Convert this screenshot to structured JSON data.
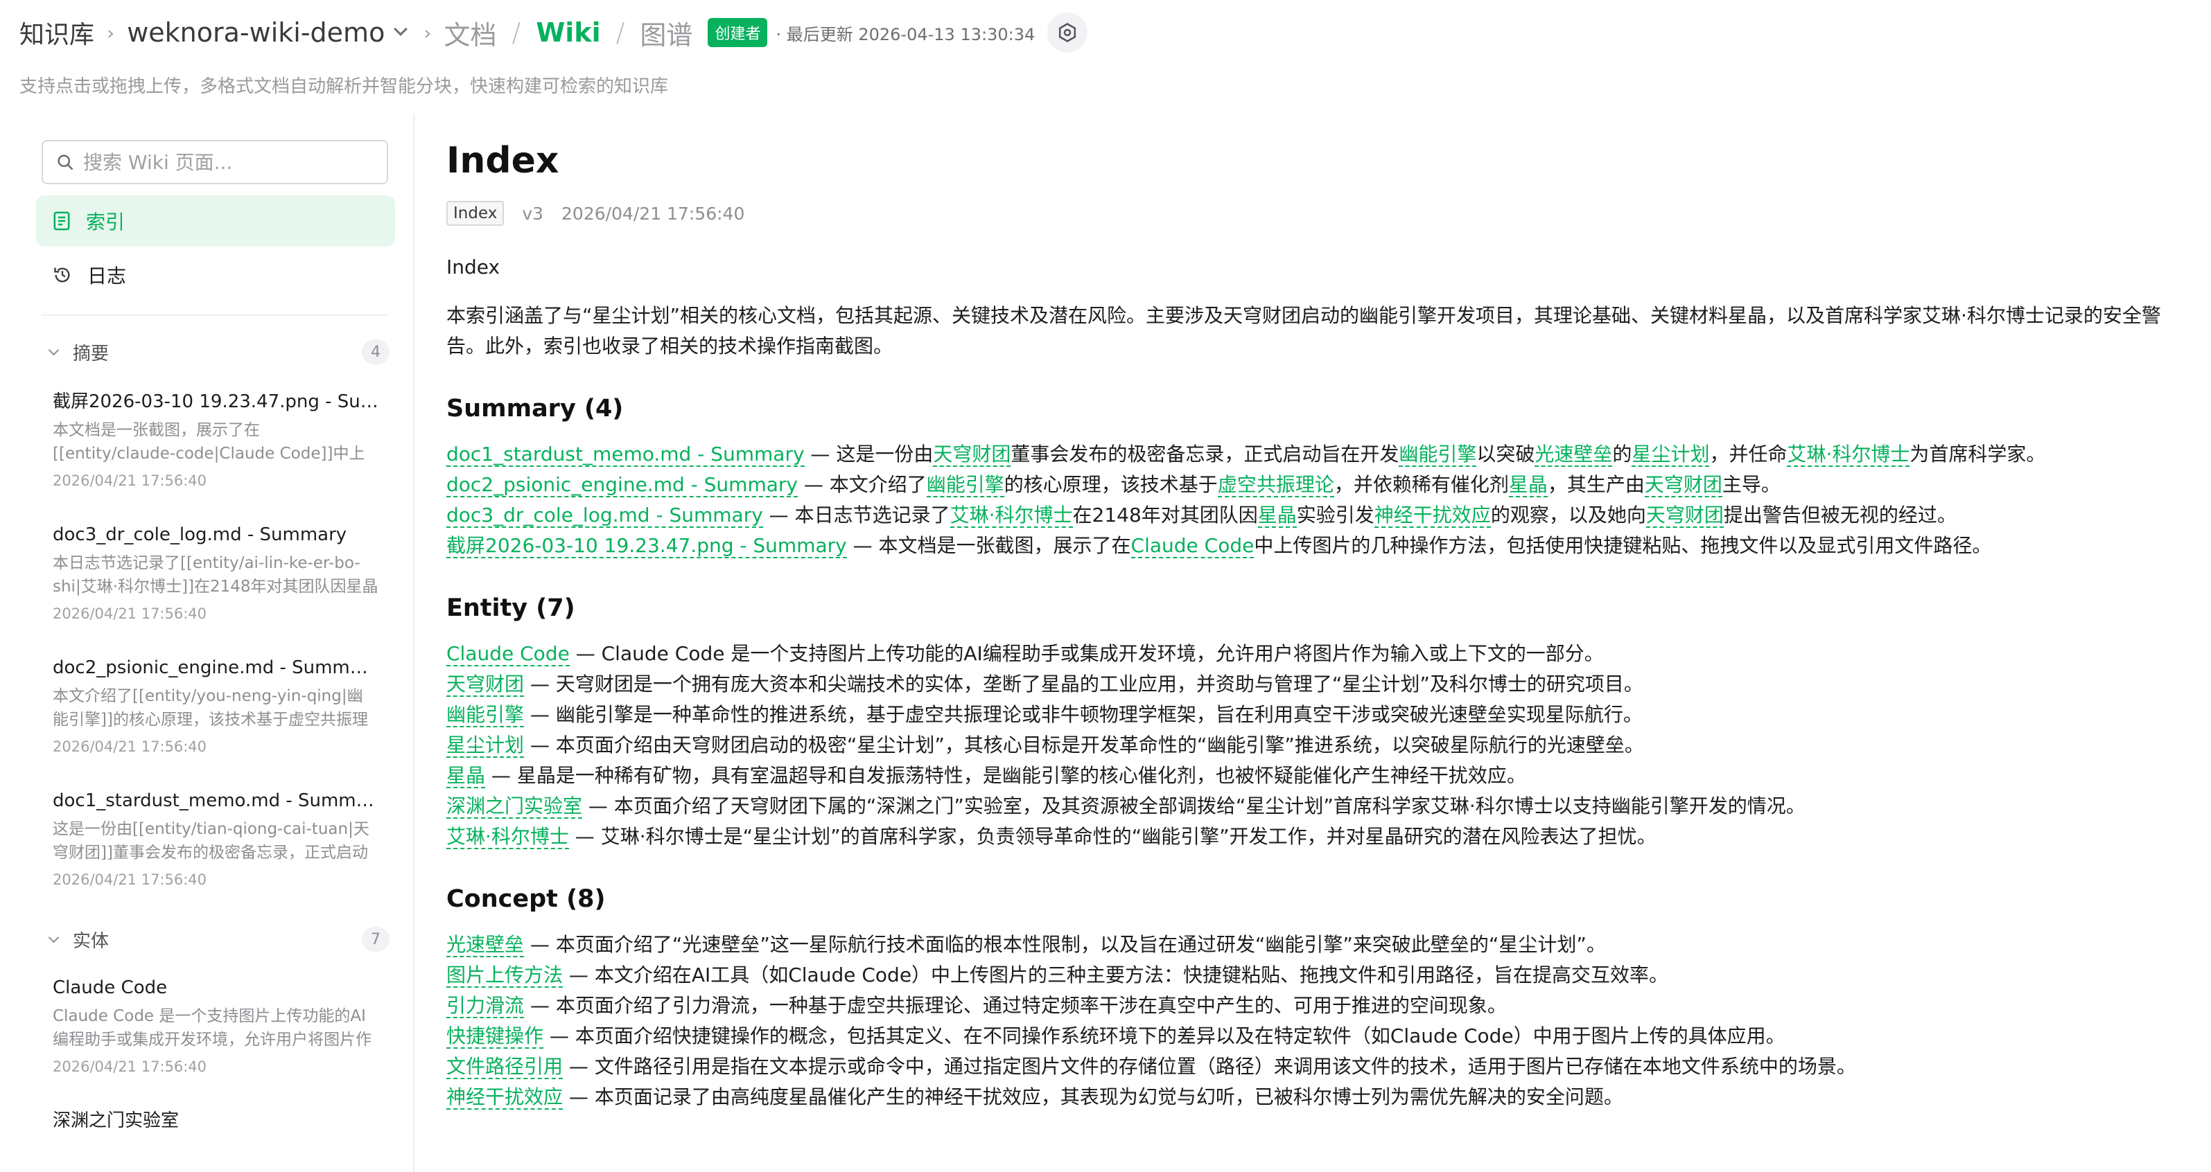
{
  "header": {
    "root": "知识库",
    "kb_name": "weknora-wiki-demo",
    "tabs": [
      "文档",
      "Wiki",
      "图谱"
    ],
    "active_tab": "Wiki",
    "role_badge": "创建者",
    "updated_text": "· 最后更新 2026-04-13 13:30:34",
    "subtitle": "支持点击或拖拽上传，多格式文档自动解析并智能分块，快速构建可检索的知识库",
    "accent_color": "#07b15d"
  },
  "sidebar": {
    "search_placeholder": "搜索 Wiki 页面...",
    "nav": [
      {
        "label": "索引",
        "icon": "document-icon",
        "active": true
      },
      {
        "label": "日志",
        "icon": "history-icon",
        "active": false
      }
    ],
    "groups": [
      {
        "title": "摘要",
        "count": "4",
        "items": [
          {
            "title": "截屏2026-03-10 19.23.47.png - Summary",
            "desc": "本文档是一张截图，展示了在[[entity/claude-code|Claude Code]]中上传图片的几种操作方法",
            "time": "2026/04/21 17:56:40"
          },
          {
            "title": "doc3_dr_cole_log.md - Summary",
            "desc": "本日志节选记录了[[entity/ai-lin-ke-er-bo-shi|艾琳·科尔博士]]在2148年对其团队因星晶实验",
            "time": "2026/04/21 17:56:40"
          },
          {
            "title": "doc2_psionic_engine.md - Summary",
            "desc": "本文介绍了[[entity/you-neng-yin-qing|幽能引擎]]的核心原理，该技术基于虚空共振理论",
            "time": "2026/04/21 17:56:40"
          },
          {
            "title": "doc1_stardust_memo.md - Summary",
            "desc": "这是一份由[[entity/tian-qiong-cai-tuan|天穹财团]]董事会发布的极密备忘录，正式启动",
            "time": "2026/04/21 17:56:40"
          }
        ]
      },
      {
        "title": "实体",
        "count": "7",
        "items": [
          {
            "title": "Claude Code",
            "desc": "Claude Code 是一个支持图片上传功能的AI编程助手或集成开发环境，允许用户将图片作为输入",
            "time": "2026/04/21 17:56:40"
          },
          {
            "title": "深渊之门实验室",
            "desc": "",
            "time": ""
          }
        ]
      }
    ]
  },
  "page": {
    "title": "Index",
    "type_tag": "Index",
    "version": "v3",
    "updated": "2026/04/21 17:56:40",
    "heading_line": "Index",
    "intro": "本索引涵盖了与“星尘计划”相关的核心文档，包括其起源、关键技术及潜在风险。主要涉及天穹财团启动的幽能引擎开发项目，其理论基础、关键材料星晶，以及首席科学家艾琳·科尔博士记录的安全警告。此外，索引也收录了相关的技术操作指南截图。",
    "sections": [
      {
        "heading": "Summary (4)",
        "entries": [
          [
            {
              "link": "doc1_stardust_memo.md - Summary"
            },
            {
              "text": " — 这是一份由"
            },
            {
              "link": "天穹财团"
            },
            {
              "text": "董事会发布的极密备忘录，正式启动旨在开发"
            },
            {
              "link": "幽能引擎"
            },
            {
              "text": "以突破"
            },
            {
              "link": "光速壁垒"
            },
            {
              "text": "的"
            },
            {
              "link": "星尘计划"
            },
            {
              "text": "，并任命"
            },
            {
              "link": "艾琳·科尔博士"
            },
            {
              "text": "为首席科学家。"
            }
          ],
          [
            {
              "link": "doc2_psionic_engine.md - Summary"
            },
            {
              "text": " — 本文介绍了"
            },
            {
              "link": "幽能引擎"
            },
            {
              "text": "的核心原理，该技术基于"
            },
            {
              "link": "虚空共振理论"
            },
            {
              "text": "，并依赖稀有催化剂"
            },
            {
              "link": "星晶"
            },
            {
              "text": "，其生产由"
            },
            {
              "link": "天穹财团"
            },
            {
              "text": "主导。"
            }
          ],
          [
            {
              "link": "doc3_dr_cole_log.md - Summary"
            },
            {
              "text": " — 本日志节选记录了"
            },
            {
              "link": "艾琳·科尔博士"
            },
            {
              "text": "在2148年对其团队因"
            },
            {
              "link": "星晶"
            },
            {
              "text": "实验引发"
            },
            {
              "link": "神经干扰效应"
            },
            {
              "text": "的观察，以及她向"
            },
            {
              "link": "天穹财团"
            },
            {
              "text": "提出警告但被无视的经过。"
            }
          ],
          [
            {
              "link": "截屏2026-03-10 19.23.47.png - Summary"
            },
            {
              "text": " — 本文档是一张截图，展示了在"
            },
            {
              "link": "Claude Code"
            },
            {
              "text": "中上传图片的几种操作方法，包括使用快捷键粘贴、拖拽文件以及显式引用文件路径。"
            }
          ]
        ]
      },
      {
        "heading": "Entity (7)",
        "entries": [
          [
            {
              "link": "Claude Code"
            },
            {
              "text": " — Claude Code 是一个支持图片上传功能的AI编程助手或集成开发环境，允许用户将图片作为输入或上下文的一部分。"
            }
          ],
          [
            {
              "link": "天穹财团"
            },
            {
              "text": " — 天穹财团是一个拥有庞大资本和尖端技术的实体，垄断了星晶的工业应用，并资助与管理了“星尘计划”及科尔博士的研究项目。"
            }
          ],
          [
            {
              "link": "幽能引擎"
            },
            {
              "text": " — 幽能引擎是一种革命性的推进系统，基于虚空共振理论或非牛顿物理学框架，旨在利用真空干涉或突破光速壁垒实现星际航行。"
            }
          ],
          [
            {
              "link": "星尘计划"
            },
            {
              "text": " — 本页面介绍由天穹财团启动的极密“星尘计划”，其核心目标是开发革命性的“幽能引擎”推进系统，以突破星际航行的光速壁垒。"
            }
          ],
          [
            {
              "link": "星晶"
            },
            {
              "text": " — 星晶是一种稀有矿物，具有室温超导和自发振荡特性，是幽能引擎的核心催化剂，也被怀疑能催化产生神经干扰效应。"
            }
          ],
          [
            {
              "link": "深渊之门实验室"
            },
            {
              "text": " — 本页面介绍了天穹财团下属的“深渊之门”实验室，及其资源被全部调拨给“星尘计划”首席科学家艾琳·科尔博士以支持幽能引擎开发的情况。"
            }
          ],
          [
            {
              "link": "艾琳·科尔博士"
            },
            {
              "text": " — 艾琳·科尔博士是“星尘计划”的首席科学家，负责领导革命性的“幽能引擎”开发工作，并对星晶研究的潜在风险表达了担忧。"
            }
          ]
        ]
      },
      {
        "heading": "Concept (8)",
        "entries": [
          [
            {
              "link": "光速壁垒"
            },
            {
              "text": " — 本页面介绍了“光速壁垒”这一星际航行技术面临的根本性限制，以及旨在通过研发“幽能引擎”来突破此壁垒的“星尘计划”。"
            }
          ],
          [
            {
              "link": "图片上传方法"
            },
            {
              "text": " — 本文介绍在AI工具（如Claude Code）中上传图片的三种主要方法：快捷键粘贴、拖拽文件和引用路径，旨在提高交互效率。"
            }
          ],
          [
            {
              "link": "引力滑流"
            },
            {
              "text": " — 本页面介绍了引力滑流，一种基于虚空共振理论、通过特定频率干涉在真空中产生的、可用于推进的空间现象。"
            }
          ],
          [
            {
              "link": "快捷键操作"
            },
            {
              "text": " — 本页面介绍快捷键操作的概念，包括其定义、在不同操作系统环境下的差异以及在特定软件（如Claude Code）中用于图片上传的具体应用。"
            }
          ],
          [
            {
              "link": "文件路径引用"
            },
            {
              "text": " — 文件路径引用是指在文本提示或命令中，通过指定图片文件的存储位置（路径）来调用该文件的技术，适用于图片已存储在本地文件系统中的场景。"
            }
          ],
          [
            {
              "link": "神经干扰效应"
            },
            {
              "text": " — 本页面记录了由高纯度星晶催化产生的神经干扰效应，其表现为幻觉与幻听，已被科尔博士列为需优先解决的安全问题。"
            }
          ]
        ]
      }
    ]
  }
}
